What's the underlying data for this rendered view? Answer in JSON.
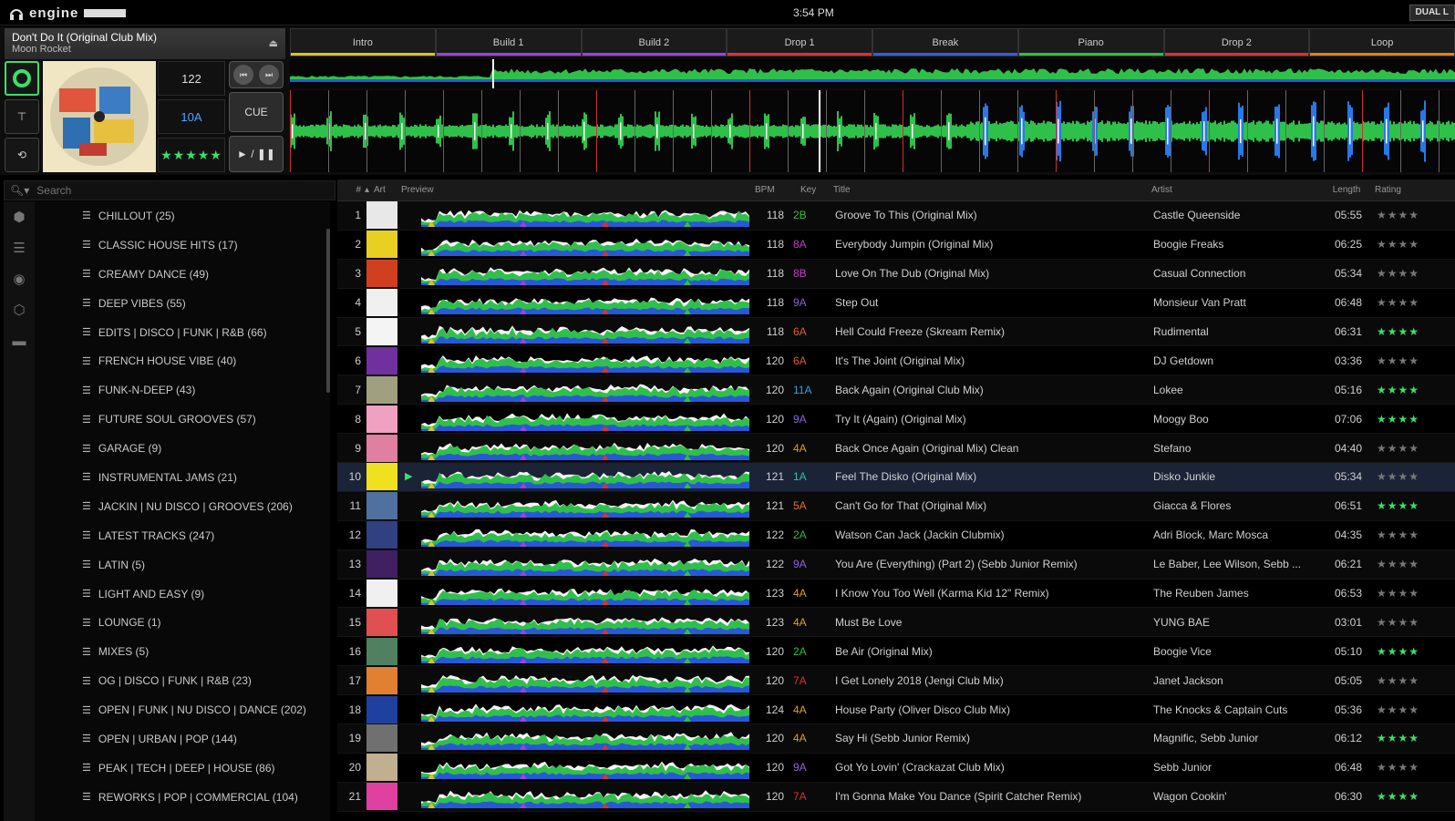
{
  "app": {
    "brand": "engine",
    "clock": "3:54 PM",
    "layout_button": "DUAL L"
  },
  "deck": {
    "title": "Don't Do It (Original Club Mix)",
    "artist": "Moon Rocket",
    "bpm": "122",
    "key": "10A",
    "rating": "★★★★★",
    "cue_label": "CUE",
    "play_label": "► / ❚❚",
    "hot_cues": [
      {
        "label": "Intro",
        "color": "#e0c020"
      },
      {
        "label": "Build 1",
        "color": "#a040e0"
      },
      {
        "label": "Build 2",
        "color": "#a040e0"
      },
      {
        "label": "Drop 1",
        "color": "#e03030"
      },
      {
        "label": "Break",
        "color": "#3060e0"
      },
      {
        "label": "Piano",
        "color": "#30c040"
      },
      {
        "label": "Drop 2",
        "color": "#e03030"
      },
      {
        "label": "Loop",
        "color": "#e08020"
      }
    ]
  },
  "search": {
    "placeholder": "Search"
  },
  "playlists": [
    "CHILLOUT (25)",
    "CLASSIC HOUSE HITS (17)",
    "CREAMY DANCE (49)",
    "DEEP VIBES (55)",
    "EDITS | DISCO | FUNK | R&B (66)",
    "FRENCH HOUSE VIBE (40)",
    "FUNK-N-DEEP (43)",
    "FUTURE SOUL GROOVES (57)",
    "GARAGE (9)",
    "INSTRUMENTAL JAMS (21)",
    "JACKIN | NU DISCO | GROOVES (206)",
    "LATEST TRACKS (247)",
    "LATIN (5)",
    "LIGHT AND EASY (9)",
    "LOUNGE (1)",
    "MIXES (5)",
    "OG | DISCO | FUNK | R&B (23)",
    "OPEN | FUNK | NU DISCO | DANCE (202)",
    "OPEN | URBAN | POP (144)",
    "PEAK | TECH | DEEP | HOUSE (86)",
    "REWORKS | POP | COMMERCIAL (104)"
  ],
  "columns": {
    "num": "#",
    "art": "Art",
    "preview": "Preview",
    "bpm": "BPM",
    "key": "Key",
    "title": "Title",
    "artist": "Artist",
    "length": "Length",
    "rating": "Rating"
  },
  "tracks": [
    {
      "num": "1",
      "bpm": "118",
      "key": "2B",
      "key_color": "#30c040",
      "title": "Groove To This (Original Mix)",
      "artist": "Castle Queenside",
      "length": "05:55",
      "rating": "★★★★",
      "rated": false
    },
    {
      "num": "2",
      "bpm": "118",
      "key": "8A",
      "key_color": "#c040c0",
      "title": "Everybody Jumpin (Original Mix)",
      "artist": "Boogie Freaks",
      "length": "06:25",
      "rating": "★★★★",
      "rated": false
    },
    {
      "num": "3",
      "bpm": "118",
      "key": "8B",
      "key_color": "#c040c0",
      "title": "Love On The Dub (Original Mix)",
      "artist": "Casual Connection",
      "length": "05:34",
      "rating": "★★★★",
      "rated": false
    },
    {
      "num": "4",
      "bpm": "118",
      "key": "9A",
      "key_color": "#9060e0",
      "title": "Step Out",
      "artist": "Monsieur Van Pratt",
      "length": "06:48",
      "rating": "★★★★",
      "rated": false
    },
    {
      "num": "5",
      "bpm": "118",
      "key": "6A",
      "key_color": "#e06030",
      "title": "Hell Could Freeze (Skream Remix)",
      "artist": "Rudimental",
      "length": "06:31",
      "rating": "★★★★",
      "rated": true
    },
    {
      "num": "6",
      "bpm": "120",
      "key": "6A",
      "key_color": "#e06030",
      "title": "It's The Joint (Original Mix)",
      "artist": "DJ Getdown",
      "length": "03:36",
      "rating": "★★★★",
      "rated": false
    },
    {
      "num": "7",
      "bpm": "120",
      "key": "11A",
      "key_color": "#30a0e0",
      "title": "Back Again (Original Club Mix)",
      "artist": "Lokee",
      "length": "05:16",
      "rating": "★★★★",
      "rated": true
    },
    {
      "num": "8",
      "bpm": "120",
      "key": "9A",
      "key_color": "#9060e0",
      "title": "Try It (Again) (Original Mix)",
      "artist": "Moogy Boo",
      "length": "07:06",
      "rating": "★★★★",
      "rated": true
    },
    {
      "num": "9",
      "bpm": "120",
      "key": "4A",
      "key_color": "#e0a020",
      "title": "Back Once Again (Original Mix) Clean",
      "artist": "Stefano",
      "length": "04:40",
      "rating": "★★★★",
      "rated": false
    },
    {
      "num": "10",
      "bpm": "121",
      "key": "1A",
      "key_color": "#30c0b0",
      "title": "Feel The Disko (Original Mix)",
      "artist": "Disko Junkie",
      "length": "05:34",
      "rating": "★★★★",
      "rated": false,
      "selected": true
    },
    {
      "num": "11",
      "bpm": "121",
      "key": "5A",
      "key_color": "#e07030",
      "title": "Can't Go for That (Original Mix)",
      "artist": "Giacca & Flores",
      "length": "06:51",
      "rating": "★★★★",
      "rated": true
    },
    {
      "num": "12",
      "bpm": "122",
      "key": "2A",
      "key_color": "#30c040",
      "title": "Watson Can Jack (Jackin Clubmix)",
      "artist": "Adri Block, Marc Mosca",
      "length": "04:35",
      "rating": "★★★★",
      "rated": false
    },
    {
      "num": "13",
      "bpm": "122",
      "key": "9A",
      "key_color": "#9060e0",
      "title": "You Are (Everything) (Part 2) (Sebb Junior Remix)",
      "artist": "Le Baber, Lee Wilson, Sebb ...",
      "length": "06:21",
      "rating": "★★★★",
      "rated": false
    },
    {
      "num": "14",
      "bpm": "123",
      "key": "4A",
      "key_color": "#e0a020",
      "title": "I Know You Too Well (Karma Kid 12\" Remix)",
      "artist": "The Reuben James",
      "length": "06:53",
      "rating": "★★★★",
      "rated": false
    },
    {
      "num": "15",
      "bpm": "123",
      "key": "4A",
      "key_color": "#e0a020",
      "title": "Must Be Love",
      "artist": "YUNG BAE",
      "length": "03:01",
      "rating": "★★★★",
      "rated": false
    },
    {
      "num": "16",
      "bpm": "120",
      "key": "2A",
      "key_color": "#30c040",
      "title": "Be Air (Original Mix)",
      "artist": "Boogie Vice",
      "length": "05:10",
      "rating": "★★★★",
      "rated": true
    },
    {
      "num": "17",
      "bpm": "120",
      "key": "7A",
      "key_color": "#e03030",
      "title": "I Get Lonely 2018 (Jengi Club Mix)",
      "artist": "Janet Jackson",
      "length": "05:05",
      "rating": "★★★★",
      "rated": false
    },
    {
      "num": "18",
      "bpm": "124",
      "key": "4A",
      "key_color": "#e0a020",
      "title": "House Party (Oliver Disco Club Mix)",
      "artist": "The Knocks & Captain Cuts",
      "length": "05:36",
      "rating": "★★★★",
      "rated": false
    },
    {
      "num": "19",
      "bpm": "120",
      "key": "4A",
      "key_color": "#e0a020",
      "title": "Say Hi (Sebb Junior Remix)",
      "artist": "Magnific, Sebb Junior",
      "length": "06:12",
      "rating": "★★★★",
      "rated": true
    },
    {
      "num": "20",
      "bpm": "120",
      "key": "9A",
      "key_color": "#9060e0",
      "title": "Got Yo Lovin' (Crackazat Club Mix)",
      "artist": "Sebb Junior",
      "length": "06:48",
      "rating": "★★★★",
      "rated": false
    },
    {
      "num": "21",
      "bpm": "120",
      "key": "7A",
      "key_color": "#e03030",
      "title": "I'm Gonna Make You Dance (Spirit Catcher Remix)",
      "artist": "Wagon Cookin'",
      "length": "06:30",
      "rating": "★★★★",
      "rated": true
    }
  ]
}
